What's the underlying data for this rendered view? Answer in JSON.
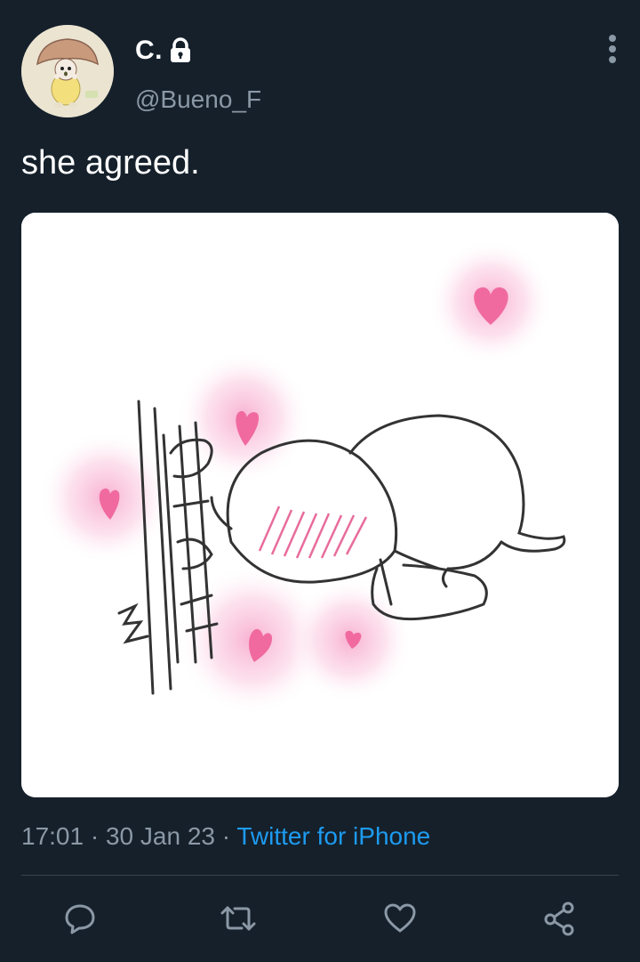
{
  "user": {
    "display_name": "C.",
    "handle": "@Bueno_F",
    "protected_icon": "lock-icon",
    "avatar_icon": "mushroom-character-avatar"
  },
  "tweet": {
    "text": "she agreed.",
    "time": "17:01",
    "separator": "·",
    "date": "30 Jan 23",
    "source": "Twitter for iPhone",
    "media_description_icon": "drawing-hugging-door-with-hearts"
  },
  "actions": [
    {
      "name": "reply",
      "icon": "reply-icon"
    },
    {
      "name": "retweet",
      "icon": "retweet-icon"
    },
    {
      "name": "like",
      "icon": "heart-icon"
    },
    {
      "name": "share",
      "icon": "share-icon"
    }
  ],
  "colors": {
    "background": "#15202b",
    "secondary_text": "#8b98a5",
    "link": "#1d9bf0",
    "divider": "#38444d"
  }
}
